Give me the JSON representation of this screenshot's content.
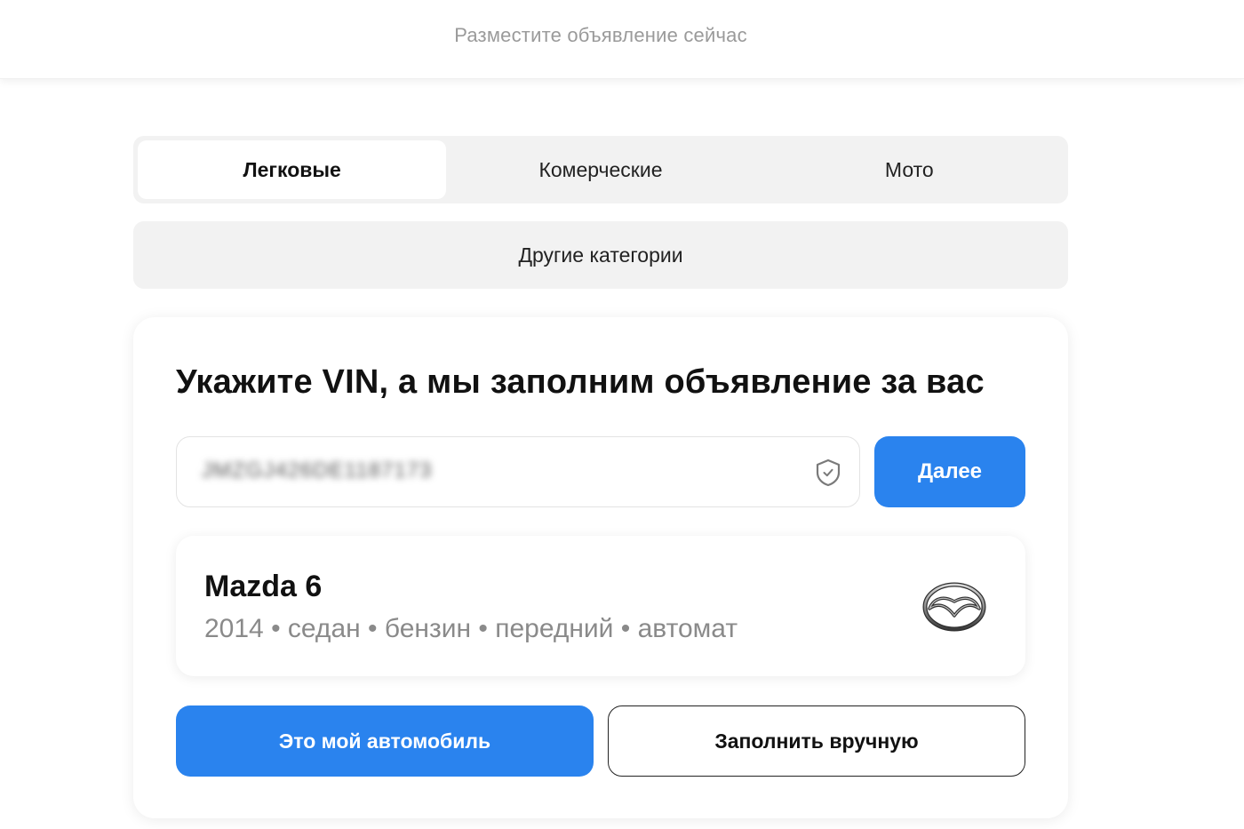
{
  "header": {
    "title": "Разместите объявление сейчас"
  },
  "tabs": [
    {
      "label": "Легковые",
      "active": true
    },
    {
      "label": "Комерческие",
      "active": false
    },
    {
      "label": "Мото",
      "active": false
    }
  ],
  "other_categories": {
    "label": "Другие категории"
  },
  "vin_form": {
    "title": "Укажите VIN, а мы заполним объявление за вас",
    "vin_value": "JMZGJ426DE1187173",
    "next_button": "Далее",
    "shield_icon": "shield-check-icon"
  },
  "car": {
    "model": "Mazda 6",
    "specs": "2014 • седан • бензин • передний • автомат",
    "logo_icon": "mazda-logo-icon"
  },
  "actions": {
    "confirm_label": "Это мой автомобиль",
    "manual_label": "Заполнить вручную"
  },
  "colors": {
    "accent": "#2a83ee",
    "tab_background": "#f2f2f2",
    "muted_text": "#8a8a8a"
  }
}
